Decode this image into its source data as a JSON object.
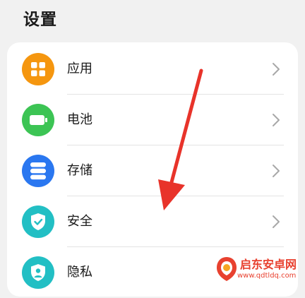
{
  "page": {
    "title": "设置"
  },
  "settings": {
    "items": [
      {
        "label": "应用",
        "icon": "apps-grid-icon",
        "color": "#f5960f"
      },
      {
        "label": "电池",
        "icon": "battery-icon",
        "color": "#3cc454"
      },
      {
        "label": "存储",
        "icon": "storage-icon",
        "color": "#2a77f0"
      },
      {
        "label": "安全",
        "icon": "shield-check-icon",
        "color": "#22bfc4"
      },
      {
        "label": "隐私",
        "icon": "privacy-shield-icon",
        "color": "#22bfc4"
      }
    ]
  },
  "annotation": {
    "arrow_color": "#e8332a"
  },
  "watermark": {
    "name": "启东安卓网",
    "url": "www.qdtldq.com",
    "color": "#e8412f"
  }
}
